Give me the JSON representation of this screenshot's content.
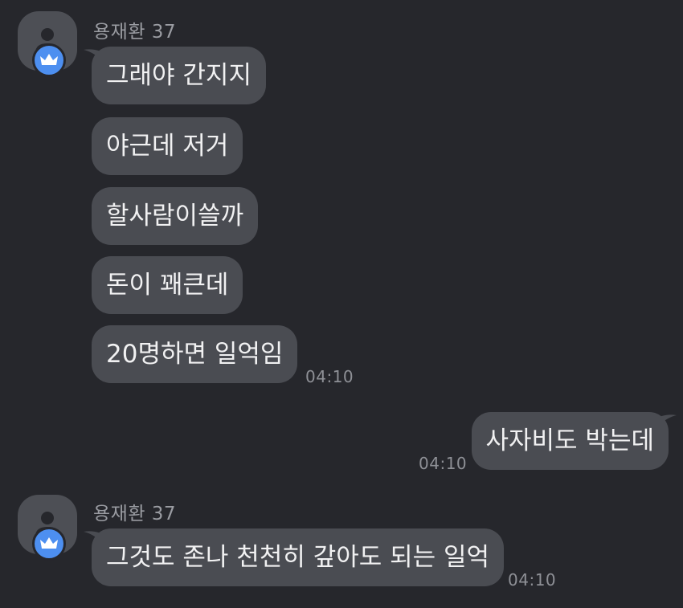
{
  "messages": [
    {
      "sender": "용재환 37",
      "bubbles": [
        "그래야 간지지",
        "야근데 저거",
        "할사람이쓸까",
        "돈이 꽤큰데",
        "20명하면 일억임"
      ],
      "time": "04:10"
    },
    {
      "sender": "me",
      "bubbles": [
        "사자비도 박는데"
      ],
      "time": "04:10"
    },
    {
      "sender": "용재환 37",
      "bubbles": [
        "그것도 존나 천천히 갚아도 되는 일억"
      ],
      "time": "04:10"
    }
  ],
  "colors": {
    "background": "#26272c",
    "bubble": "#4a4c52",
    "crown_badge": "#4d8ff0",
    "timestamp": "#8e9096"
  },
  "icons": {
    "avatar": "person-silhouette-icon",
    "badge": "crown-icon"
  }
}
